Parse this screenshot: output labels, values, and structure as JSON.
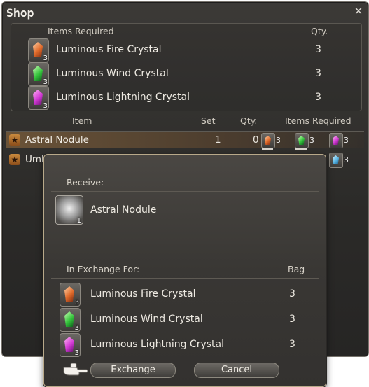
{
  "window": {
    "title": "Shop"
  },
  "required_panel": {
    "header_items": "Items Required",
    "header_qty": "Qty.",
    "rows": [
      {
        "name": "Luminous Fire Crystal",
        "count": "3",
        "qty": "3",
        "element": "fire"
      },
      {
        "name": "Luminous Wind Crystal",
        "count": "3",
        "qty": "3",
        "element": "wind"
      },
      {
        "name": "Luminous Lightning Crystal",
        "count": "3",
        "qty": "3",
        "element": "lightning"
      }
    ]
  },
  "list": {
    "headers": {
      "item": "Item",
      "set": "Set",
      "qty": "Qty.",
      "items_required": "Items Required"
    },
    "rows": [
      {
        "name": "Astral Nodule",
        "set": "1",
        "qty": "0",
        "req": [
          "3",
          "3",
          "3"
        ]
      },
      {
        "name": "Umb",
        "req_last": "3"
      }
    ]
  },
  "dialog": {
    "receive_label": "Receive:",
    "receive_item": {
      "name": "Astral Nodule",
      "count": "1"
    },
    "exchange_label": "In Exchange For:",
    "bag_label": "Bag",
    "exchange_rows": [
      {
        "name": "Luminous Fire Crystal",
        "count": "3",
        "bag": "3",
        "element": "fire"
      },
      {
        "name": "Luminous Wind Crystal",
        "count": "3",
        "bag": "3",
        "element": "wind"
      },
      {
        "name": "Luminous Lightning Crystal",
        "count": "3",
        "bag": "3",
        "element": "lightning"
      }
    ],
    "exchange_button": "Exchange",
    "cancel_button": "Cancel"
  }
}
